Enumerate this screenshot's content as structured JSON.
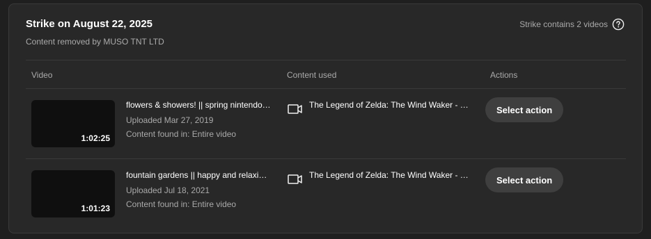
{
  "strike": {
    "title": "Strike on August 22, 2025",
    "subtitle": "Content removed by MUSO TNT LTD",
    "count_text": "Strike contains 2 videos",
    "help_icon": "question-circle-icon"
  },
  "table": {
    "headers": {
      "video": "Video",
      "content": "Content used",
      "actions": "Actions"
    },
    "rows": [
      {
        "title": "flowers & showers! || spring nintendo music to relax",
        "uploaded": "Uploaded Mar 27, 2019",
        "found": "Content found in: Entire video",
        "duration": "1:02:25",
        "content_icon": "video-camera-icon",
        "content_title": "The Legend of Zelda: The Wind Waker - Dragon Roost Island",
        "action_label": "Select action"
      },
      {
        "title": "fountain gardens || happy and relaxing nintendo music",
        "uploaded": "Uploaded Jul 18, 2021",
        "found": "Content found in: Entire video",
        "duration": "1:01:23",
        "content_icon": "video-camera-icon",
        "content_title": "The Legend of Zelda: The Wind Waker - Outset Island",
        "action_label": "Select action"
      }
    ]
  },
  "colors": {
    "page_bg": "#1f1f1f",
    "card_bg": "#282828",
    "divider": "#3a3a3a",
    "text_primary": "#ffffff",
    "text_secondary": "#aaaaaa",
    "button_bg": "#3f3f3f",
    "thumbnail_bg": "#0f0f0f"
  }
}
